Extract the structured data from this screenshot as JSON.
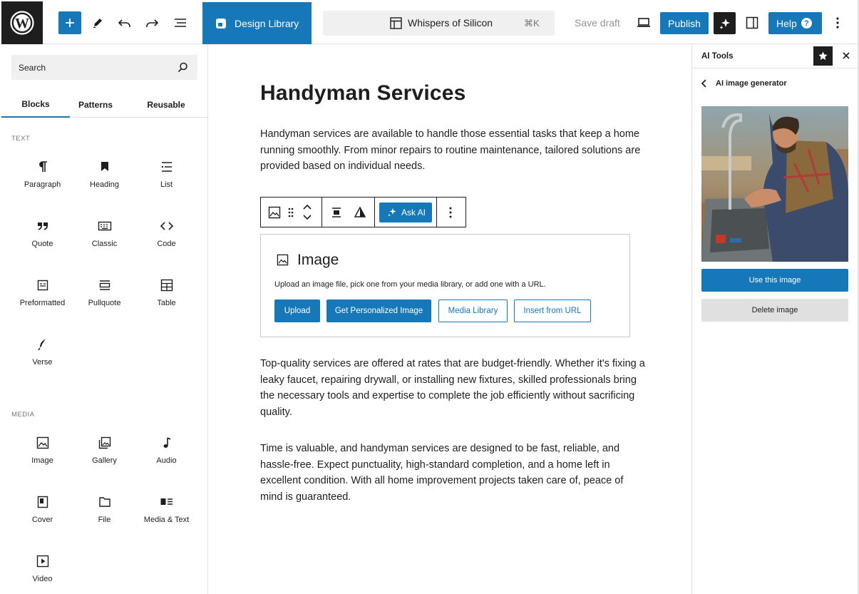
{
  "topbar": {
    "design_library": "Design Library",
    "document_title": "Whispers of Silicon",
    "shortcut": "⌘K",
    "save_draft": "Save draft",
    "publish": "Publish",
    "help": "Help",
    "help_glyph": "?"
  },
  "inserter": {
    "search_placeholder": "Search",
    "tabs": [
      "Blocks",
      "Patterns",
      "Reusable"
    ],
    "active_tab": "Blocks",
    "text_section": "TEXT",
    "text_blocks": [
      "Paragraph",
      "Heading",
      "List",
      "Quote",
      "Classic",
      "Code",
      "Preformatted",
      "Pullquote",
      "Table",
      "Verse"
    ],
    "media_section": "MEDIA",
    "media_blocks": [
      "Image",
      "Gallery",
      "Audio",
      "Cover",
      "File",
      "Media & Text",
      "Video"
    ]
  },
  "canvas": {
    "title": "Handyman Services",
    "para1": "Handyman services are available to handle those essential tasks that keep a home running smoothly. From minor repairs to routine maintenance, tailored solutions are provided based on individual needs.",
    "toolbar": {
      "ask_ai": "Ask AI"
    },
    "image_block": {
      "title": "Image",
      "instructions": "Upload an image file, pick one from your media library, or add one with a URL.",
      "buttons": [
        "Upload",
        "Get Personalized Image",
        "Media Library",
        "Insert from URL"
      ]
    },
    "para2": "Top-quality services are offered at rates that are budget-friendly. Whether it's fixing a leaky faucet, repairing drywall, or installing new fixtures, skilled professionals bring the necessary tools and expertise to complete the job efficiently without sacrificing quality.",
    "para3": "Time is valuable, and handyman services are designed to be fast, reliable, and hassle-free. Expect punctuality, high-standard completion, and a home left in excellent condition. With all home improvement projects taken care of, peace of mind is guaranteed."
  },
  "ai_panel": {
    "title": "AI Tools",
    "subtitle": "AI image generator",
    "use_image": "Use this image",
    "delete_image": "Delete image"
  },
  "colors": {
    "accent": "#1778b9",
    "dark": "#1e1e1e",
    "border": "#e0e0e0"
  }
}
